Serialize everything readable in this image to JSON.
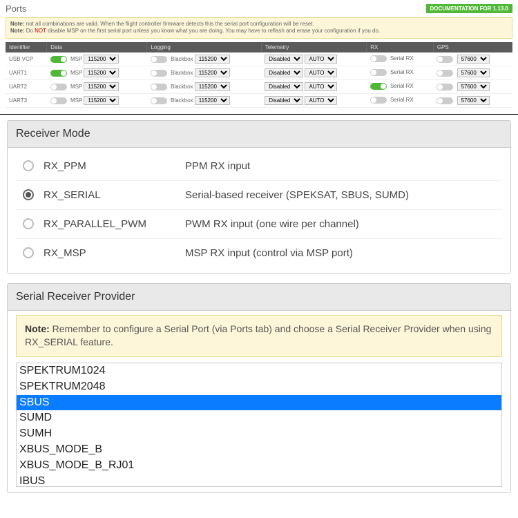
{
  "ports": {
    "title": "Ports",
    "docBadge": "DOCUMENTATION FOR 1.13.0",
    "note1": "not all combinations are valid. When the flight controller firmware detects this the serial port configuration will be reset.",
    "note2a": "Do ",
    "note2b": "NOT",
    "note2c": " disable MSP on the first serial port unless you know what you are doing. You may have to reflash and erase your configuration if you do.",
    "headers": [
      "Identifier",
      "Data",
      "Logging",
      "Telemetry",
      "RX",
      "GPS"
    ],
    "rows": [
      {
        "id": "USB VCP",
        "msp": true,
        "dataBaud": "115200",
        "logLabel": "Blackbox",
        "logBaud": "115200",
        "telMode": "Disabled",
        "telAuto": "AUTO",
        "rx": false,
        "rxLabel": "Serial RX",
        "gps": false,
        "gpsBaud": "57600"
      },
      {
        "id": "UART1",
        "msp": true,
        "dataBaud": "115200",
        "logLabel": "Blackbox",
        "logBaud": "115200",
        "telMode": "Disabled",
        "telAuto": "AUTO",
        "rx": false,
        "rxLabel": "Serial RX",
        "gps": false,
        "gpsBaud": "57600"
      },
      {
        "id": "UART2",
        "msp": false,
        "dataBaud": "115200",
        "logLabel": "Blackbox",
        "logBaud": "115200",
        "telMode": "Disabled",
        "telAuto": "AUTO",
        "rx": true,
        "rxLabel": "Serial RX",
        "gps": false,
        "gpsBaud": "57600"
      },
      {
        "id": "UART3",
        "msp": false,
        "dataBaud": "115200",
        "logLabel": "Blackbox",
        "logBaud": "115200",
        "telMode": "Disabled",
        "telAuto": "AUTO",
        "rx": false,
        "rxLabel": "Serial RX",
        "gps": false,
        "gpsBaud": "57600"
      }
    ],
    "mspLabel": "MSP"
  },
  "receiver": {
    "title": "Receiver Mode",
    "options": [
      {
        "name": "RX_PPM",
        "desc": "PPM RX input",
        "selected": false
      },
      {
        "name": "RX_SERIAL",
        "desc": "Serial-based receiver (SPEKSAT, SBUS, SUMD)",
        "selected": true
      },
      {
        "name": "RX_PARALLEL_PWM",
        "desc": "PWM RX input (one wire per channel)",
        "selected": false
      },
      {
        "name": "RX_MSP",
        "desc": "MSP RX input (control via MSP port)",
        "selected": false
      }
    ]
  },
  "provider": {
    "title": "Serial Receiver Provider",
    "noteBold": "Note:",
    "noteText": " Remember to configure a Serial Port (via Ports tab) and choose a Serial Receiver Provider when using RX_SERIAL feature.",
    "items": [
      {
        "name": "SPEKTRUM1024",
        "selected": false
      },
      {
        "name": "SPEKTRUM2048",
        "selected": false
      },
      {
        "name": "SBUS",
        "selected": true
      },
      {
        "name": "SUMD",
        "selected": false
      },
      {
        "name": "SUMH",
        "selected": false
      },
      {
        "name": "XBUS_MODE_B",
        "selected": false
      },
      {
        "name": "XBUS_MODE_B_RJ01",
        "selected": false
      },
      {
        "name": "IBUS",
        "selected": false
      }
    ]
  }
}
